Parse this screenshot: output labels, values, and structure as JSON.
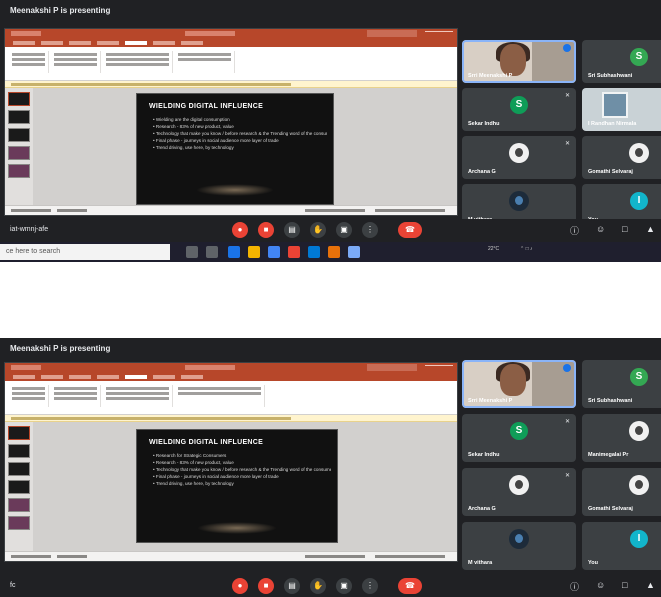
{
  "shot1": {
    "presenting_label": "Meenakshi P is presenting",
    "meeting_code": "iat-wmnj-afe",
    "search_placeholder": "ce here to search",
    "weather": "22°C",
    "slide": {
      "title": "WIELDING DIGITAL INFLUENCE",
      "bullets": [
        "Wielding are the digital consumption",
        "Research - 83% of new product, value",
        "Technology that make you know / before research & the Trending word of the consumer",
        "Final phase - journeys in social audience more layer of trade",
        "Trend driving, use here, by technology"
      ]
    },
    "participants": [
      {
        "name": "Srri Meenakshi P",
        "kind": "video"
      },
      {
        "name": "Sri Subhashwani",
        "kind": "initial",
        "initial": "S",
        "color": "#34a853"
      },
      {
        "name": "Sekar Indhu",
        "kind": "initial",
        "initial": "S",
        "color": "#0f9d58"
      },
      {
        "name": "I Randhan Nirmala",
        "kind": "shop"
      },
      {
        "name": "Archana G",
        "kind": "pic"
      },
      {
        "name": "Gomathi Selvaraj",
        "kind": "pic"
      },
      {
        "name": "M vithara",
        "kind": "dark"
      },
      {
        "name": "You",
        "kind": "initial",
        "initial": "I",
        "color": "#12b5cb"
      }
    ]
  },
  "shot2": {
    "presenting_label": "Meenakshi P is presenting",
    "meeting_code": "fc",
    "slide": {
      "title": "WIELDING DIGITAL INFLUENCE",
      "bullets": [
        "Research for Strategic Consumers",
        "Research - 83% of new product, value",
        "Technology that make you know / before research & the Trending word of the consumer",
        "Final phase - journeys in social audience more layer of trade",
        "Trend driving, use here, by technology"
      ]
    },
    "participants": [
      {
        "name": "Srri Meenakshi P",
        "kind": "video"
      },
      {
        "name": "Sri Subhashwani",
        "kind": "initial",
        "initial": "S",
        "color": "#34a853"
      },
      {
        "name": "Sekar Indhu",
        "kind": "initial",
        "initial": "S",
        "color": "#0f9d58"
      },
      {
        "name": "Manimegalai Pr",
        "kind": "pic"
      },
      {
        "name": "Archana G",
        "kind": "pic"
      },
      {
        "name": "Gomathi Selvaraj",
        "kind": "pic"
      },
      {
        "name": "M vithara",
        "kind": "dark"
      },
      {
        "name": "You",
        "kind": "initial",
        "initial": "I",
        "color": "#12b5cb"
      }
    ]
  },
  "icons": {
    "mic": "mic-off-icon",
    "camera": "camera-off-icon",
    "captions": "captions-icon",
    "raise_hand": "raise-hand-icon",
    "present": "present-screen-icon",
    "more": "more-options-icon",
    "hangup": "hang-up-icon",
    "info": "info-icon",
    "people": "people-icon",
    "chat": "chat-icon",
    "activities": "activities-icon"
  },
  "colors": {
    "meet_bg": "#202124",
    "tile_bg": "#3c4043",
    "red": "#ea4335",
    "powerpoint": "#b7472a"
  }
}
